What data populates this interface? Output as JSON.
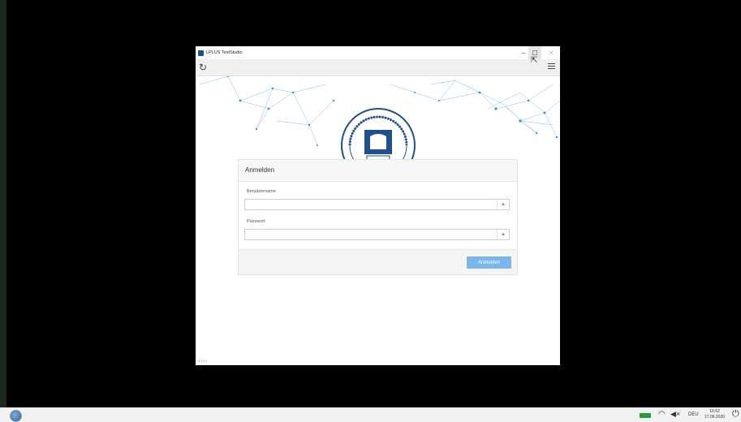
{
  "window": {
    "title": "LPLUS TestStudio",
    "minimize_glyph": "–",
    "maximize_glyph": "☐",
    "close_glyph": "✕"
  },
  "toolbar": {
    "reload_glyph": "↻",
    "menu_icon": "hamburger-menu-icon"
  },
  "login": {
    "heading": "Anmelden",
    "username_label": "Benutzername",
    "username_value": "",
    "password_label": "Passwort",
    "password_value": "",
    "username_addon_glyph": "▲",
    "password_addon_glyph": "▲",
    "submit_label": "Anmelden"
  },
  "version": "6.2X.1",
  "taskbar": {
    "language": "DEU",
    "time": "16:52",
    "date": "17.06.2020",
    "wifi_glyph": "◠",
    "volume_glyph": "◀×",
    "power_glyph": "⏻"
  },
  "colors": {
    "accent_button": "#7ab7ee",
    "battery": "#2a9a3a",
    "network_lines": "#3d8fd0",
    "seal": "#1f4f8f"
  }
}
